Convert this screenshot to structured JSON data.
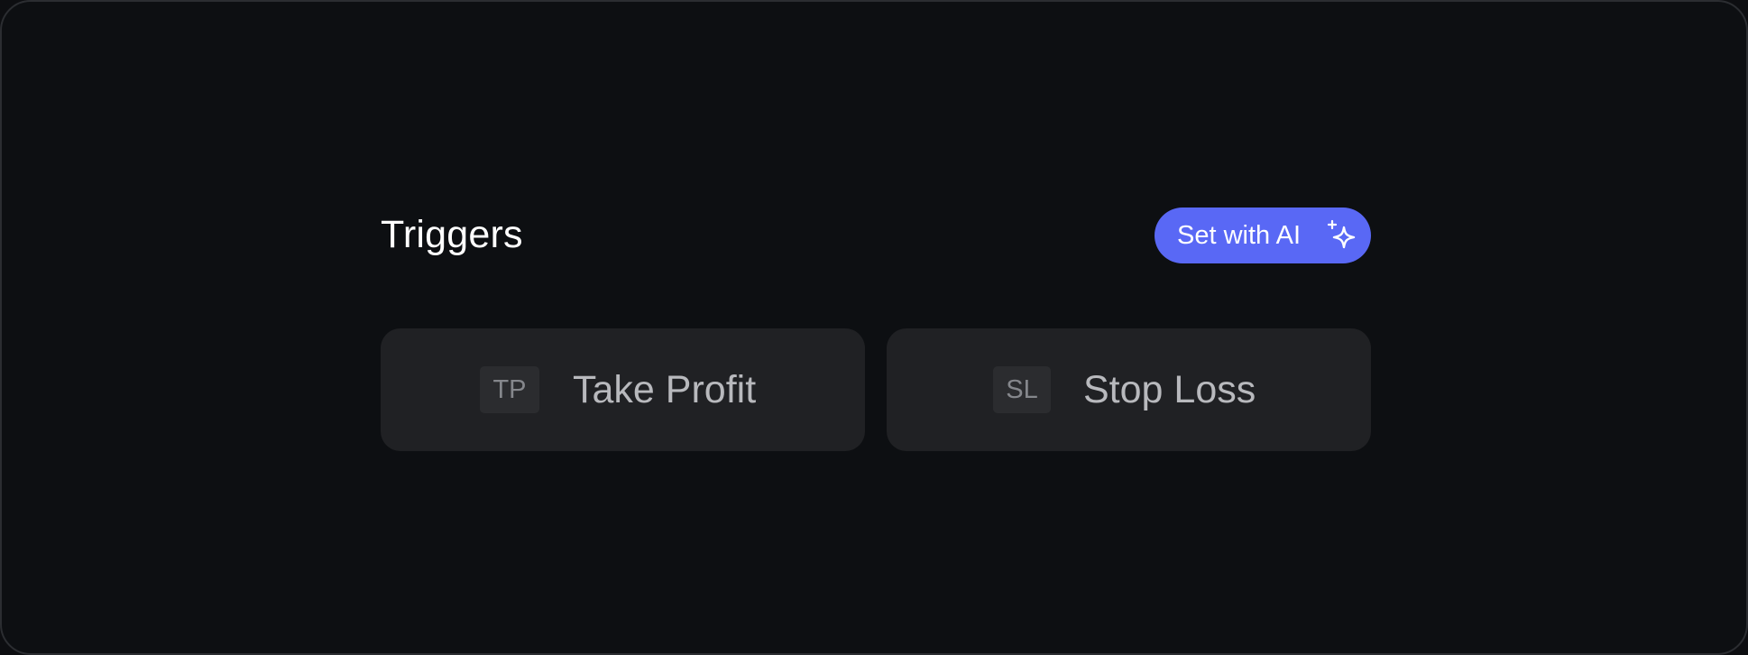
{
  "section": {
    "title": "Triggers"
  },
  "ai_button": {
    "label": "Set with AI",
    "icon": "sparkle-icon",
    "background_color": "#5968f5"
  },
  "triggers": [
    {
      "abbr": "TP",
      "label": "Take Profit"
    },
    {
      "abbr": "SL",
      "label": "Stop Loss"
    }
  ],
  "colors": {
    "page_background": "#0d0f12",
    "card_background": "#202124",
    "badge_background": "#2b2c2f"
  }
}
